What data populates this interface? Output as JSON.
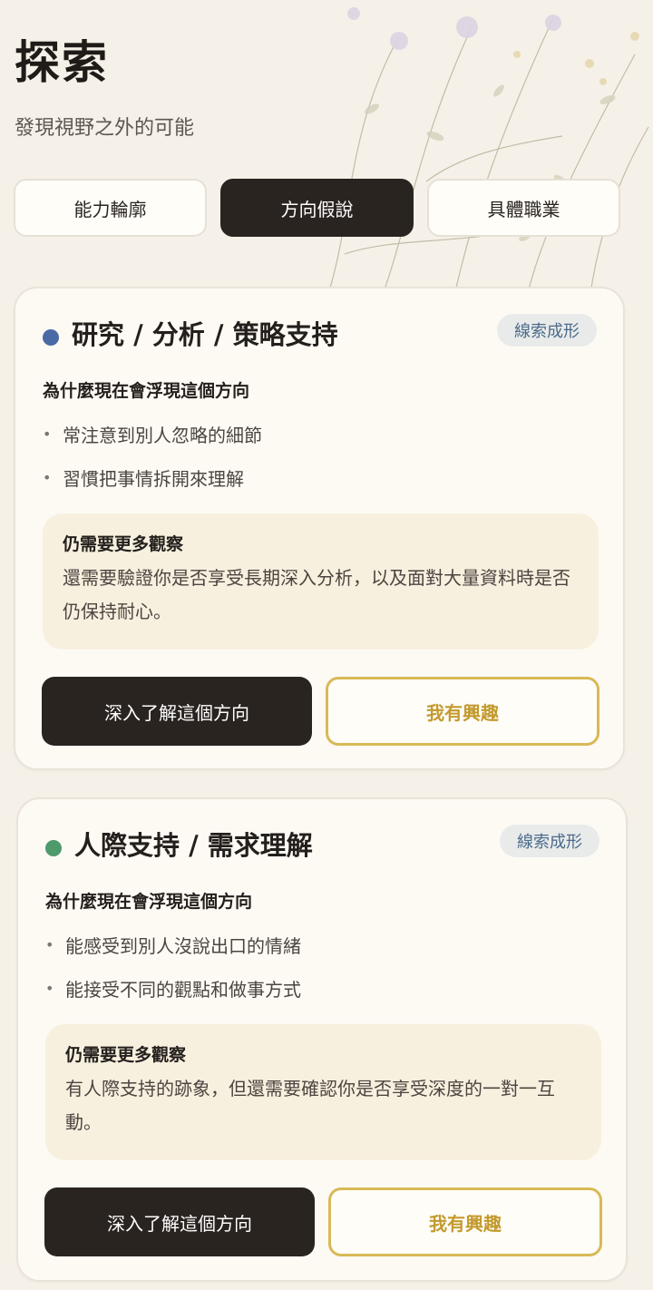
{
  "header": {
    "title": "探索",
    "subtitle": "發現視野之外的可能"
  },
  "tabs": [
    {
      "label": "能力輪廓",
      "active": false
    },
    {
      "label": "方向假說",
      "active": true
    },
    {
      "label": "具體職業",
      "active": false
    }
  ],
  "cards": [
    {
      "dot_color": "#4a6aa6",
      "title": "研究 / 分析 / 策略支持",
      "badge": "線索成形",
      "why_heading": "為什麼現在會浮現這個方向",
      "bullets": [
        "常注意到別人忽略的細節",
        "習慣把事情拆開來理解"
      ],
      "note_heading": "仍需要更多觀察",
      "note_body": "還需要驗證你是否享受長期深入分析，以及面對大量資料時是否仍保持耐心。",
      "primary_button": "深入了解這個方向",
      "secondary_button": "我有興趣"
    },
    {
      "dot_color": "#4f9a6b",
      "title": "人際支持 / 需求理解",
      "badge": "線索成形",
      "why_heading": "為什麼現在會浮現這個方向",
      "bullets": [
        "能感受到別人沒說出口的情緒",
        "能接受不同的觀點和做事方式"
      ],
      "note_heading": "仍需要更多觀察",
      "note_body": "有人際支持的跡象，但還需要確認你是否享受深度的一對一互動。",
      "primary_button": "深入了解這個方向",
      "secondary_button": "我有興趣"
    }
  ],
  "icons": {
    "bullet": "bullet-dot",
    "background": "botanical-illustration"
  }
}
